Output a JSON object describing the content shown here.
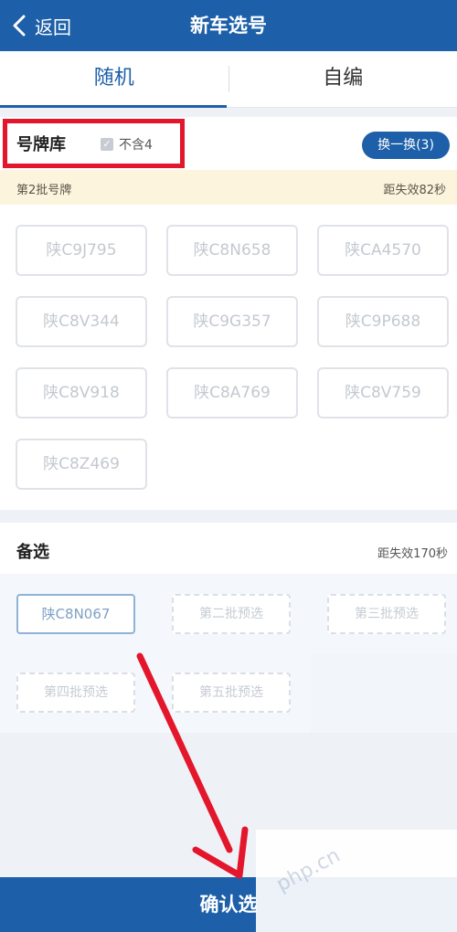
{
  "header": {
    "back_label": "返回",
    "title": "新车选号"
  },
  "tabs": [
    {
      "label": "随机",
      "active": true
    },
    {
      "label": "自编",
      "active": false
    }
  ],
  "library": {
    "title": "号牌库",
    "checkbox_label": "不含4",
    "checkbox_checked": true,
    "swap_label": "换一换(3)",
    "batch_label": "第2批号牌",
    "expire_label": "距失效82秒",
    "plates": [
      "陕C9J795",
      "陕C8N658",
      "陕CA4570",
      "陕C8V344",
      "陕C9G357",
      "陕C9P688",
      "陕C8V918",
      "陕C8A769",
      "陕C8V759",
      "陕C8Z469"
    ]
  },
  "alternates": {
    "title": "备选",
    "expire_label": "距失效170秒",
    "slots": [
      "陕C8N067",
      "第二批预选",
      "第三批预选",
      "第四批预选",
      "第五批预选"
    ]
  },
  "confirm_label": "确认选",
  "watermark": "php.cn",
  "colors": {
    "brand": "#1d5fa8",
    "highlight": "#e3162b",
    "notice_bg": "#fdf4dd"
  }
}
